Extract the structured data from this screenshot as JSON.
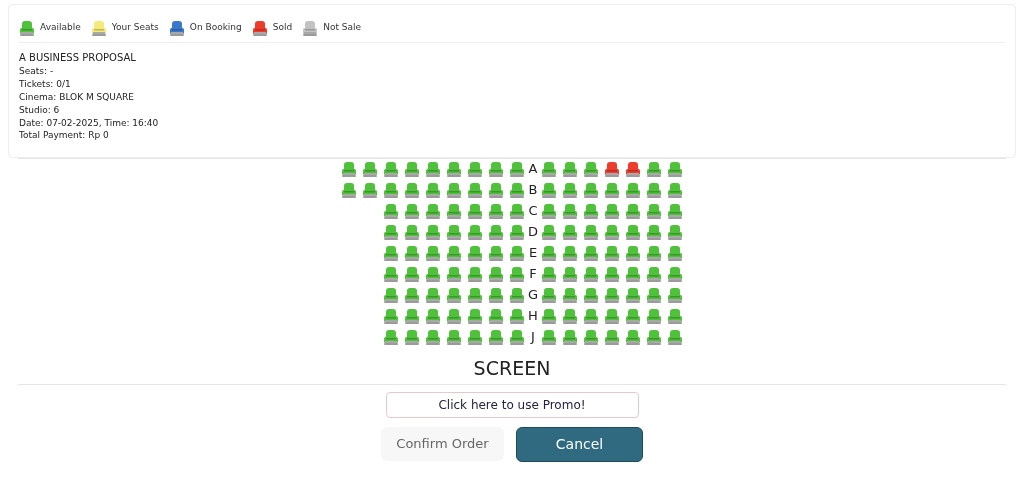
{
  "legend": [
    {
      "label": "Available",
      "color": "#4fc13a"
    },
    {
      "label": "Your Seats",
      "color": "#f2ea7a"
    },
    {
      "label": "On Booking",
      "color": "#3a78cc"
    },
    {
      "label": "Sold",
      "color": "#ee3b2b"
    },
    {
      "label": "Not Sale",
      "color": "#c2c2c2"
    }
  ],
  "movie": {
    "title": "A BUSINESS PROPOSAL",
    "lines": [
      "Seats: -",
      "Tickets: 0/1",
      "Cinema: BLOK M SQUARE",
      "Studio: 6",
      "Date: 07-02-2025, Time: 16:40",
      "Total Payment: Rp 0"
    ]
  },
  "rows": [
    {
      "label": "A",
      "left": [
        {
          "color": "#4fc13a"
        },
        {
          "color": "#4fc13a"
        },
        {
          "color": "#4fc13a"
        },
        {
          "color": "#4fc13a"
        },
        {
          "color": "#4fc13a"
        },
        {
          "color": "#4fc13a"
        },
        {
          "color": "#4fc13a"
        },
        {
          "color": "#4fc13a"
        },
        {
          "color": "#4fc13a"
        }
      ],
      "right": [
        {
          "color": "#4fc13a"
        },
        {
          "color": "#4fc13a"
        },
        {
          "color": "#4fc13a"
        },
        {
          "color": "#ee3b2b"
        },
        {
          "color": "#ee3b2b"
        },
        {
          "color": "#4fc13a"
        },
        {
          "color": "#4fc13a"
        }
      ]
    },
    {
      "label": "B",
      "left": [
        {
          "color": "#4fc13a"
        },
        {
          "color": "#4fc13a"
        },
        {
          "color": "#4fc13a"
        },
        {
          "color": "#4fc13a"
        },
        {
          "color": "#4fc13a"
        },
        {
          "color": "#4fc13a"
        },
        {
          "color": "#4fc13a"
        },
        {
          "color": "#4fc13a"
        },
        {
          "color": "#4fc13a"
        }
      ],
      "right": [
        {
          "color": "#4fc13a"
        },
        {
          "color": "#4fc13a"
        },
        {
          "color": "#4fc13a"
        },
        {
          "color": "#4fc13a"
        },
        {
          "color": "#4fc13a"
        },
        {
          "color": "#4fc13a"
        },
        {
          "color": "#4fc13a"
        }
      ]
    },
    {
      "label": "C",
      "left": [
        {
          "color": "#4fc13a"
        },
        {
          "color": "#4fc13a"
        },
        {
          "color": "#4fc13a"
        },
        {
          "color": "#4fc13a"
        },
        {
          "color": "#4fc13a"
        },
        {
          "color": "#4fc13a"
        },
        {
          "color": "#4fc13a"
        }
      ],
      "right": [
        {
          "color": "#4fc13a"
        },
        {
          "color": "#4fc13a"
        },
        {
          "color": "#4fc13a"
        },
        {
          "color": "#4fc13a"
        },
        {
          "color": "#4fc13a"
        },
        {
          "color": "#4fc13a"
        },
        {
          "color": "#4fc13a"
        }
      ]
    },
    {
      "label": "D",
      "left": [
        {
          "color": "#4fc13a"
        },
        {
          "color": "#4fc13a"
        },
        {
          "color": "#4fc13a"
        },
        {
          "color": "#4fc13a"
        },
        {
          "color": "#4fc13a"
        },
        {
          "color": "#4fc13a"
        },
        {
          "color": "#4fc13a"
        }
      ],
      "right": [
        {
          "color": "#4fc13a"
        },
        {
          "color": "#4fc13a"
        },
        {
          "color": "#4fc13a"
        },
        {
          "color": "#4fc13a"
        },
        {
          "color": "#4fc13a"
        },
        {
          "color": "#4fc13a"
        },
        {
          "color": "#4fc13a"
        }
      ]
    },
    {
      "label": "E",
      "left": [
        {
          "color": "#4fc13a"
        },
        {
          "color": "#4fc13a"
        },
        {
          "color": "#4fc13a"
        },
        {
          "color": "#4fc13a"
        },
        {
          "color": "#4fc13a"
        },
        {
          "color": "#4fc13a"
        },
        {
          "color": "#4fc13a"
        }
      ],
      "right": [
        {
          "color": "#4fc13a"
        },
        {
          "color": "#4fc13a"
        },
        {
          "color": "#4fc13a"
        },
        {
          "color": "#4fc13a"
        },
        {
          "color": "#4fc13a"
        },
        {
          "color": "#4fc13a"
        },
        {
          "color": "#4fc13a"
        }
      ]
    },
    {
      "label": "F",
      "left": [
        {
          "color": "#4fc13a"
        },
        {
          "color": "#4fc13a"
        },
        {
          "color": "#4fc13a"
        },
        {
          "color": "#4fc13a"
        },
        {
          "color": "#4fc13a"
        },
        {
          "color": "#4fc13a"
        },
        {
          "color": "#4fc13a"
        }
      ],
      "right": [
        {
          "color": "#4fc13a"
        },
        {
          "color": "#4fc13a"
        },
        {
          "color": "#4fc13a"
        },
        {
          "color": "#4fc13a"
        },
        {
          "color": "#4fc13a"
        },
        {
          "color": "#4fc13a"
        },
        {
          "color": "#4fc13a"
        }
      ]
    },
    {
      "label": "G",
      "left": [
        {
          "color": "#4fc13a"
        },
        {
          "color": "#4fc13a"
        },
        {
          "color": "#4fc13a"
        },
        {
          "color": "#4fc13a"
        },
        {
          "color": "#4fc13a"
        },
        {
          "color": "#4fc13a"
        },
        {
          "color": "#4fc13a"
        }
      ],
      "right": [
        {
          "color": "#4fc13a"
        },
        {
          "color": "#4fc13a"
        },
        {
          "color": "#4fc13a"
        },
        {
          "color": "#4fc13a"
        },
        {
          "color": "#4fc13a"
        },
        {
          "color": "#4fc13a"
        },
        {
          "color": "#4fc13a"
        }
      ]
    },
    {
      "label": "H",
      "left": [
        {
          "color": "#4fc13a"
        },
        {
          "color": "#4fc13a"
        },
        {
          "color": "#4fc13a"
        },
        {
          "color": "#4fc13a"
        },
        {
          "color": "#4fc13a"
        },
        {
          "color": "#4fc13a"
        },
        {
          "color": "#4fc13a"
        }
      ],
      "right": [
        {
          "color": "#4fc13a"
        },
        {
          "color": "#4fc13a"
        },
        {
          "color": "#4fc13a"
        },
        {
          "color": "#4fc13a"
        },
        {
          "color": "#4fc13a"
        },
        {
          "color": "#4fc13a"
        },
        {
          "color": "#4fc13a"
        }
      ]
    },
    {
      "label": "J",
      "left": [
        {
          "color": "#4fc13a"
        },
        {
          "color": "#4fc13a"
        },
        {
          "color": "#4fc13a"
        },
        {
          "color": "#4fc13a"
        },
        {
          "color": "#4fc13a"
        },
        {
          "color": "#4fc13a"
        },
        {
          "color": "#4fc13a"
        }
      ],
      "right": [
        {
          "color": "#4fc13a"
        },
        {
          "color": "#4fc13a"
        },
        {
          "color": "#4fc13a"
        },
        {
          "color": "#4fc13a"
        },
        {
          "color": "#4fc13a"
        },
        {
          "color": "#4fc13a"
        },
        {
          "color": "#4fc13a"
        }
      ]
    }
  ],
  "screen_label": "SCREEN",
  "promo_button": "Click here to use Promo!",
  "buttons": [
    {
      "label": "Confirm Order",
      "kind": "secondary"
    },
    {
      "label": "Cancel",
      "kind": "primary"
    }
  ]
}
